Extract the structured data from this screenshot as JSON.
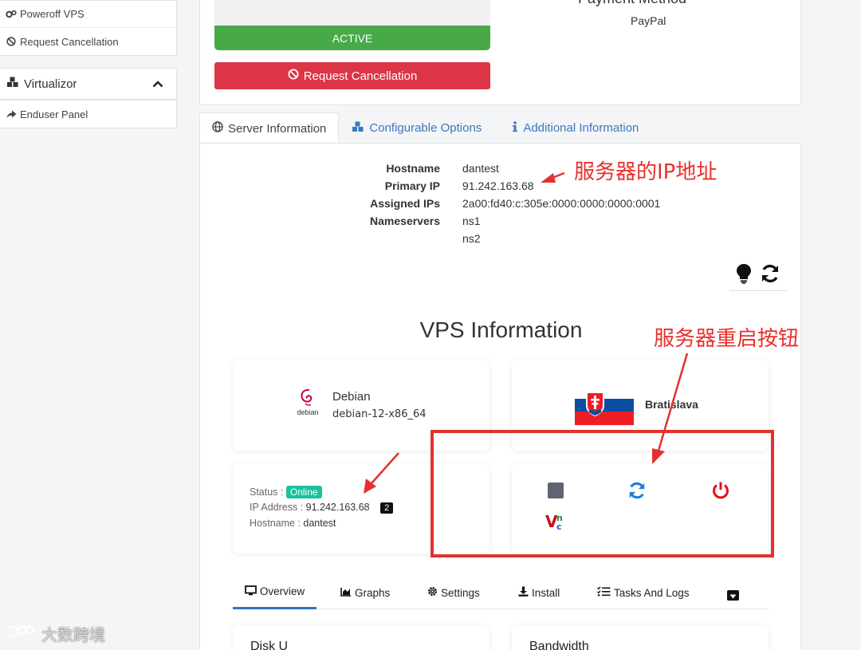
{
  "sidebar": {
    "items_top": [
      {
        "icon": "gears-icon",
        "label": "Poweroff VPS"
      },
      {
        "icon": "ban-icon",
        "label": "Request Cancellation"
      }
    ],
    "section_title": "Virtualizor",
    "section_items": [
      {
        "icon": "share-icon",
        "label": "Enduser Panel"
      }
    ]
  },
  "top": {
    "status_label": "ACTIVE",
    "cancel_label": "Request Cancellation",
    "payment_title": "Payment Method",
    "payment_value": "PayPal"
  },
  "tabs": [
    {
      "label": "Server Information",
      "icon": "globe-icon"
    },
    {
      "label": "Configurable Options",
      "icon": "cubes-icon"
    },
    {
      "label": "Additional Information",
      "icon": "info-icon"
    }
  ],
  "server": {
    "rows": [
      {
        "key": "Hostname",
        "value": "dantest"
      },
      {
        "key": "Primary IP",
        "value": "91.242.163.68"
      },
      {
        "key": "Assigned IPs",
        "value": "2a00:fd40:c:305e:0000:0000:0000:0001"
      },
      {
        "key": "Nameservers",
        "value": "ns1"
      },
      {
        "key": "",
        "value": "ns2"
      }
    ]
  },
  "vps": {
    "title": "VPS Information",
    "os_name": "Debian",
    "os_version": "debian-12-x86_64",
    "os_logo_text": "debian",
    "location": "Bratislava",
    "status_label": "Status :",
    "status_value": "Online",
    "ip_label": "IP Address :",
    "ip_value": "91.242.163.68",
    "ip_count": "2",
    "host_label": "Hostname :",
    "host_value": "dantest",
    "controls": [
      "stop-icon",
      "restart-icon",
      "power-icon",
      "vnc-icon"
    ]
  },
  "subnav": [
    {
      "label": "Overview",
      "icon": "monitor-icon"
    },
    {
      "label": "Graphs",
      "icon": "chart-icon"
    },
    {
      "label": "Settings",
      "icon": "gear-icon"
    },
    {
      "label": "Install",
      "icon": "download-icon"
    },
    {
      "label": "Tasks And Logs",
      "icon": "tasks-icon"
    }
  ],
  "bottom_cards": [
    "Disk U",
    "Bandwidth"
  ],
  "annotations": {
    "ip_note": "服务器的IP地址",
    "restart_note": "服务器重启按钮",
    "watermark": "大数跨境"
  },
  "colors": {
    "active_green": "#48a948",
    "cancel_red": "#dc3545",
    "link_blue": "#3a78c0",
    "online_teal": "#19c29b",
    "annotation_red": "#e8302c"
  }
}
